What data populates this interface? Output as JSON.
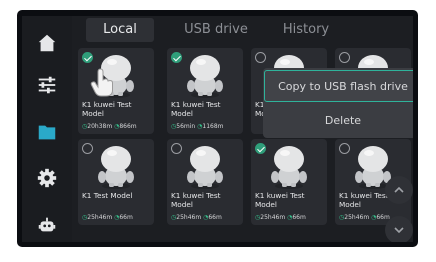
{
  "colors": {
    "accent": "#2fb39b",
    "check_on": "#2f9e7a",
    "meta_icon": "#35c08c",
    "sidebar_active": "#2aa9c9"
  },
  "sidebar": {
    "items": [
      {
        "icon": "home-icon",
        "active": false
      },
      {
        "icon": "sliders-icon",
        "active": false
      },
      {
        "icon": "folder-icon",
        "active": true
      },
      {
        "icon": "gear-icon",
        "active": false
      },
      {
        "icon": "robot-icon",
        "active": false
      }
    ]
  },
  "tabs": [
    {
      "label": "Local",
      "active": true
    },
    {
      "label": "USB drive",
      "active": false
    },
    {
      "label": "History",
      "active": false
    }
  ],
  "files": [
    {
      "name": "K1 kuwei Test Model",
      "time": "20h38m",
      "length": "866m",
      "checked": true
    },
    {
      "name": "K1 kuwei Test Model",
      "time": "56min",
      "length": "1168m",
      "checked": true
    },
    {
      "name": "K1 kuwei Test Model",
      "time": "",
      "length": "",
      "checked": false
    },
    {
      "name": "K1 kuwei Test Model",
      "time": "",
      "length": "",
      "checked": false
    },
    {
      "name": "K1 Test Model",
      "time": "25h46m",
      "length": "66m",
      "checked": false
    },
    {
      "name": "K1 kuwei Test Model",
      "time": "25h46m",
      "length": "66m",
      "checked": false
    },
    {
      "name": "K1 kuwei Test Model",
      "time": "25h46m",
      "length": "66m",
      "checked": true
    },
    {
      "name": "K1 kuwei Test Model",
      "time": "25h46m",
      "length": "66m",
      "checked": false
    }
  ],
  "context_menu": {
    "copy_label": "Copy to USB flash drive",
    "delete_label": "Delete"
  }
}
